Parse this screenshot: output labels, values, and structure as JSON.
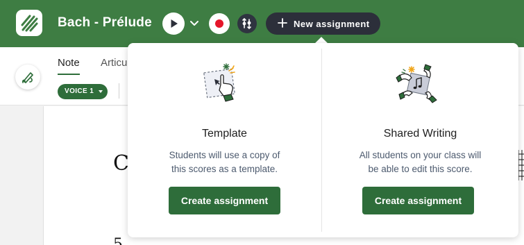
{
  "app": {
    "title": "Bach - Prélude",
    "brand_color": "#3e7d43",
    "accent_color": "#2e6d3a"
  },
  "header": {
    "new_assignment_label": "New assignment",
    "icons": [
      "logo-icon",
      "play-icon",
      "chevron-down-icon",
      "record-icon",
      "metronome-icon",
      "plus-icon"
    ]
  },
  "toolbar": {
    "tabs": [
      {
        "label": "Note",
        "active": true
      },
      {
        "label": "Articu",
        "active": false
      }
    ],
    "voice_label": "VOICE 1"
  },
  "score": {
    "visible_glyph_top": "C",
    "visible_glyph_bottom": "5"
  },
  "assignment_menu": {
    "options": [
      {
        "title": "Template",
        "description_line1": "Students will use a copy of",
        "description_line2": "this scores as a template.",
        "button_label": "Create assignment",
        "illustration": "hand-pointer-icon"
      },
      {
        "title": "Shared Writing",
        "description_line1": "All students on your class will",
        "description_line2": "be able to edit this score.",
        "button_label": "Create assignment",
        "illustration": "shared-hands-icon"
      }
    ]
  }
}
